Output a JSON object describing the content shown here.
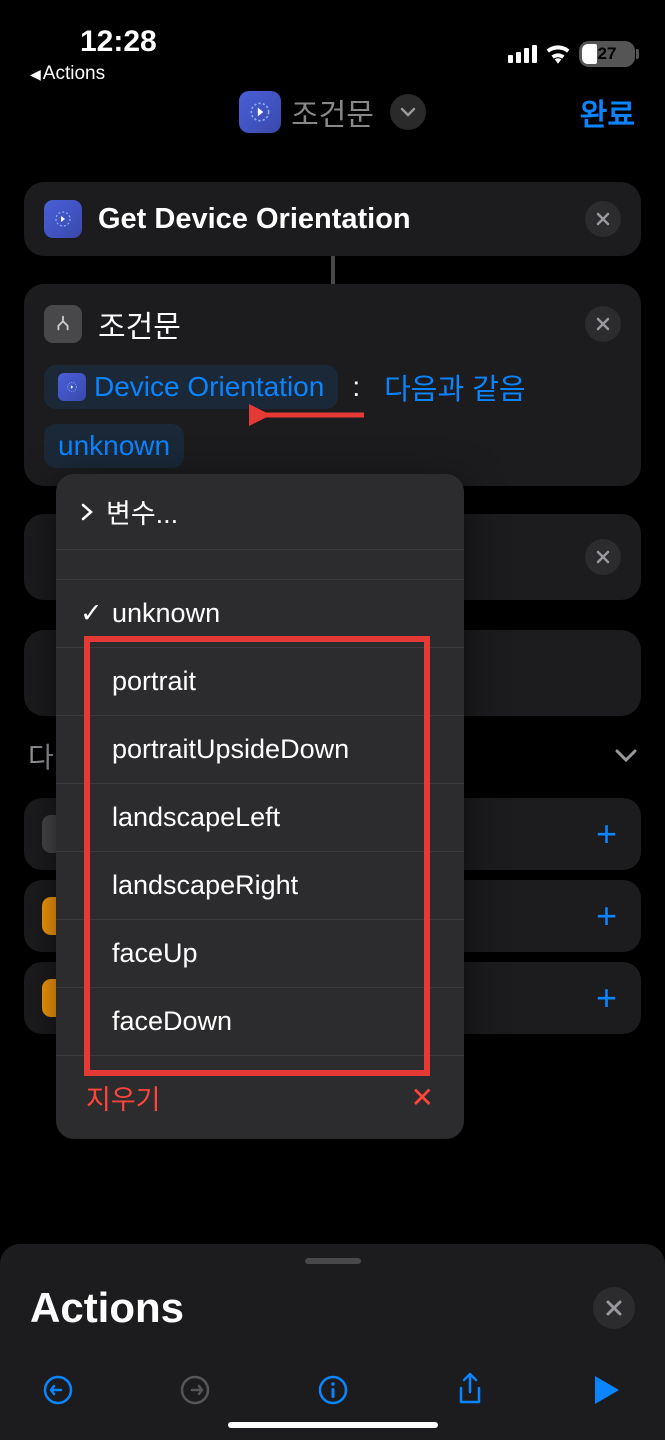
{
  "status": {
    "time": "12:28",
    "back_label": "Actions",
    "battery_percent": "27"
  },
  "nav": {
    "title": "조건문",
    "done": "완료"
  },
  "action1": {
    "title": "Get Device Orientation"
  },
  "condition": {
    "title": "조건문",
    "variable": "Device Orientation",
    "operator": "다음과 같음",
    "value": "unknown"
  },
  "dropdown": {
    "variables": "변수...",
    "options": [
      "unknown",
      "portrait",
      "portraitUpsideDown",
      "landscapeLeft",
      "landscapeRight",
      "faceUp",
      "faceDown"
    ],
    "selected": "unknown",
    "clear": "지우기"
  },
  "next_step": {
    "label": "다"
  },
  "sheet": {
    "title": "Actions"
  }
}
